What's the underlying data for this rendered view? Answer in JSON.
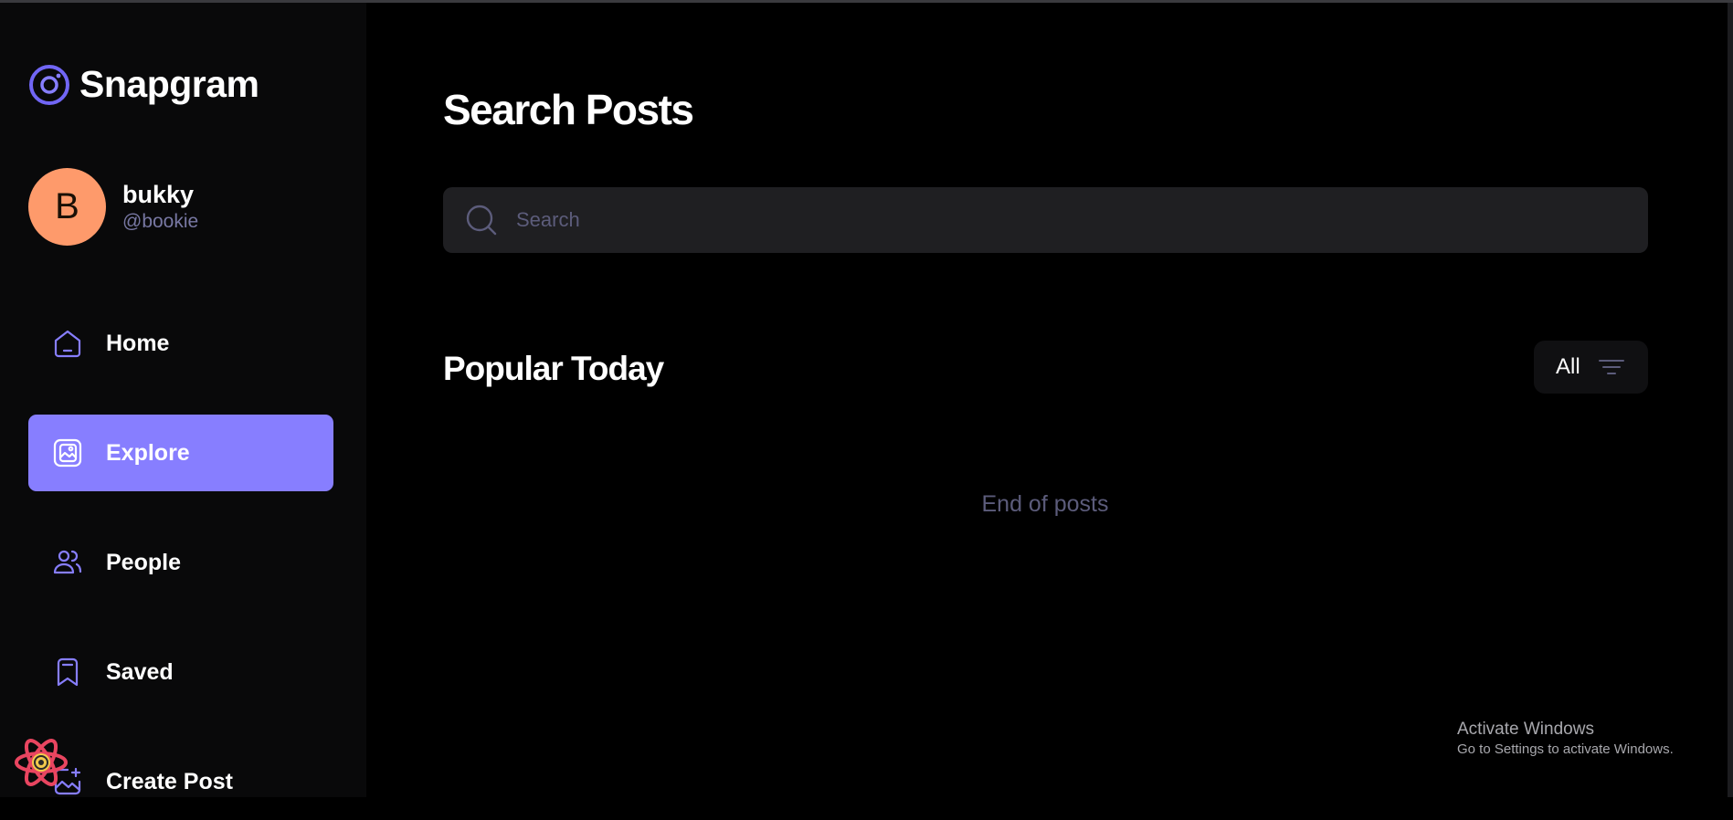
{
  "app": {
    "name": "Snapgram",
    "logo_icon": "camera-ring-icon"
  },
  "user": {
    "avatar_letter": "B",
    "name": "bukky",
    "handle": "@bookie",
    "avatar_color": "#fe9a6b"
  },
  "nav": [
    {
      "id": "home",
      "label": "Home",
      "icon": "home-icon",
      "active": false
    },
    {
      "id": "explore",
      "label": "Explore",
      "icon": "gallery-icon",
      "active": true
    },
    {
      "id": "people",
      "label": "People",
      "icon": "people-icon",
      "active": false
    },
    {
      "id": "saved",
      "label": "Saved",
      "icon": "bookmark-icon",
      "active": false
    },
    {
      "id": "create-post",
      "label": "Create Post",
      "icon": "image-add-icon",
      "active": false
    }
  ],
  "main": {
    "title": "Search Posts",
    "search": {
      "placeholder": "Search",
      "value": ""
    },
    "section_title": "Popular Today",
    "filter": {
      "label": "All",
      "icon": "filter-lines-icon"
    },
    "end_text": "End of posts"
  },
  "os_watermark": {
    "title": "Activate Windows",
    "subtitle": "Go to Settings to activate Windows."
  },
  "colors": {
    "accent": "#877eff",
    "background": "#000000",
    "sidebar": "#09090a",
    "input": "#1f1f22",
    "muted_text": "#5c5c7b"
  }
}
